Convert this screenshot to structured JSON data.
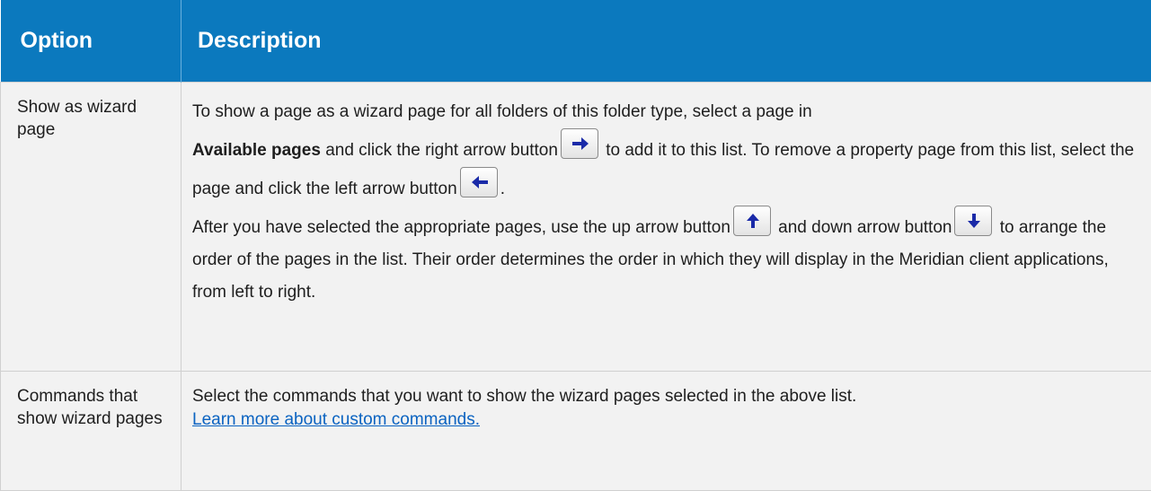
{
  "header": {
    "option": "Option",
    "description": "Description"
  },
  "rows": [
    {
      "option": "Show as wizard page",
      "p1_a": "To show a page as a wizard page for all folders of this folder type, select a page in",
      "p1_bold": "Available pages",
      "p1_b": " and click the right arrow button",
      "p1_c": " to add it to this list. To remove a property page from this list, select the page and click the left arrow button",
      "p1_d": ".",
      "p2_a": "After you have selected the appropriate pages, use the up arrow button",
      "p2_b": " and down arrow button",
      "p2_c": " to arrange the order of the pages in the list. Their order determines the order in which they will display in the Meridian client applications, from left to right."
    },
    {
      "option": "Commands that show wizard pages",
      "text": "Select the commands that you want to show the wizard pages selected in the above list.",
      "link": "Learn more about custom commands."
    }
  ],
  "icons": [
    "right-arrow-icon",
    "left-arrow-icon",
    "up-arrow-icon",
    "down-arrow-icon"
  ],
  "colors": {
    "header_bg": "#0b79be",
    "row_bg": "#f2f2f2",
    "link": "#0b63c1",
    "arrow": "#1a2aa8"
  }
}
